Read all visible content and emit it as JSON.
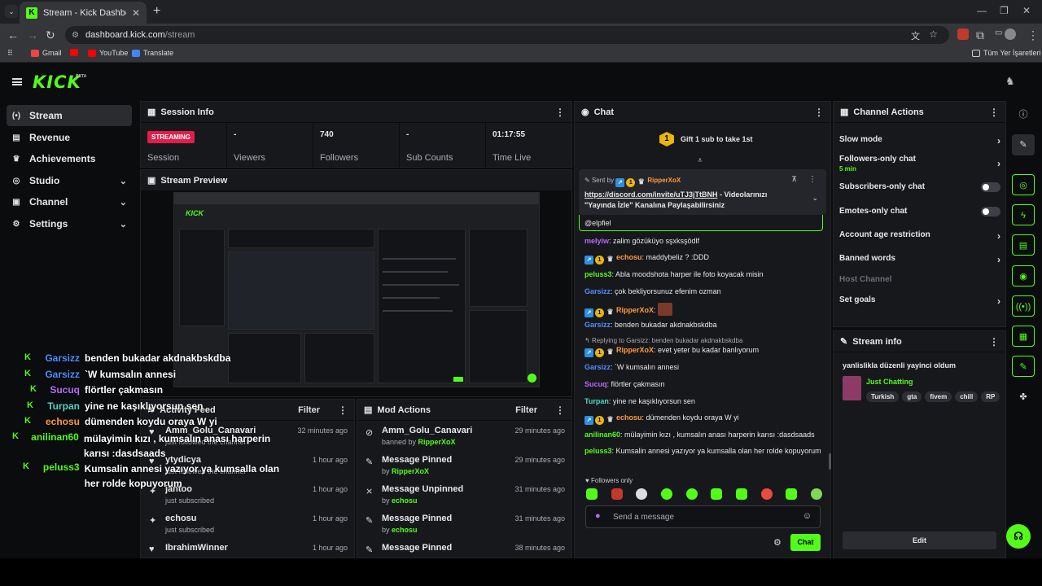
{
  "browser": {
    "tab_title": "Stream - Kick Dashboard",
    "url_host": "dashboard.kick.com",
    "url_path": "/stream",
    "bookmarks": [
      "Gmail",
      "YouTube",
      "Translate"
    ],
    "other_bookmarks": "Tüm Yer İşaretleri"
  },
  "header": {
    "logo": "KICK",
    "beta": "BETA"
  },
  "sidebar": {
    "items": [
      {
        "label": "Stream",
        "icon": "broadcast-icon"
      },
      {
        "label": "Revenue",
        "icon": "revenue-icon"
      },
      {
        "label": "Achievements",
        "icon": "trophy-icon"
      },
      {
        "label": "Studio",
        "icon": "studio-icon"
      },
      {
        "label": "Channel",
        "icon": "channel-icon"
      },
      {
        "label": "Settings",
        "icon": "gear-icon"
      }
    ]
  },
  "session": {
    "title": "Session Info",
    "status": "STREAMING",
    "cells": [
      {
        "value": "",
        "label": "Session"
      },
      {
        "value": "-",
        "label": "Viewers"
      },
      {
        "value": "740",
        "label": "Followers"
      },
      {
        "value": "-",
        "label": "Sub Counts"
      },
      {
        "value": "01:17:55",
        "label": "Time Live"
      }
    ]
  },
  "preview": {
    "title": "Stream Preview"
  },
  "overlay_chat": [
    {
      "name": "Garsizz",
      "color": "#4f8fff",
      "msg": "benden bukadar akdnakbskdba"
    },
    {
      "name": "Garsizz",
      "color": "#4f8fff",
      "msg": "`W kumsalın annesi"
    },
    {
      "name": "Sucuq",
      "color": "#b76bff",
      "msg": "flörtler çakmasın"
    },
    {
      "name": "Turpan",
      "color": "#4fd6c8",
      "msg": "yine ne kaşıklıyorsun sen"
    },
    {
      "name": "echosu",
      "color": "#ff9a3c",
      "msg": "dümenden koydu oraya W yi"
    },
    {
      "name": "anilinan60",
      "color": "#53fc18",
      "msg": "mülayimin kızı , kumsalın anası harperin karısı :dasdsaads"
    },
    {
      "name": "peluss3",
      "color": "#53fc18",
      "msg": "Kumsalin annesi yazıyor ya kumsalla olan her rolde kopuyorum"
    }
  ],
  "activity": {
    "title": "Activity Feed",
    "filter": "Filter",
    "rows": [
      {
        "name": "Amm_Golu_Canavari",
        "sub": "just followed the channel",
        "time": "32 minutes ago",
        "icon": "heart-icon"
      },
      {
        "name": "ytydicya",
        "sub": "just followed the channel",
        "time": "1 hour ago",
        "icon": "heart-icon"
      },
      {
        "name": "jantoo",
        "sub": "just subscribed",
        "time": "1 hour ago",
        "icon": "star-icon"
      },
      {
        "name": "echosu",
        "sub": "just subscribed",
        "time": "1 hour ago",
        "icon": "star-icon"
      },
      {
        "name": "IbrahimWinner",
        "sub": "",
        "time": "1 hour ago",
        "icon": "heart-icon"
      }
    ]
  },
  "modactions": {
    "title": "Mod Actions",
    "filter": "Filter",
    "rows": [
      {
        "name": "Amm_Golu_Canavari",
        "pre": "banned by ",
        "by": "RipperXoX",
        "time": "29 minutes ago",
        "icon": "ban-icon"
      },
      {
        "name": "Message Pinned",
        "pre": "by ",
        "by": "RipperXoX",
        "time": "29 minutes ago",
        "icon": "pin-icon"
      },
      {
        "name": "Message Unpinned",
        "pre": "by ",
        "by": "echosu",
        "time": "31 minutes ago",
        "icon": "unpin-icon"
      },
      {
        "name": "Message Pinned",
        "pre": "by ",
        "by": "echosu",
        "time": "31 minutes ago",
        "icon": "pin-icon"
      },
      {
        "name": "Message Pinned",
        "pre": "",
        "by": "",
        "time": "38 minutes ago",
        "icon": "pin-icon"
      }
    ]
  },
  "chat": {
    "title": "Chat",
    "gift_text": "Gift 1 sub to take 1st",
    "gift_count": "1",
    "pinned": {
      "sent_by": "Sent by",
      "user": "RipperXoX",
      "link": "https://discord.com/invite/uTJ3jTtBNH",
      "text": " - Videolarınızı \"Yayında İzle\" Kanalına Paylaşabilirsiniz"
    },
    "partial": "@elpfiel",
    "messages": [
      {
        "name": "melyiw",
        "color": "#b76bff",
        "badges": 0,
        "text": ": zalim gözüküyo sşxksşödlf"
      },
      {
        "name": "echosu",
        "color": "#ff9a3c",
        "badges": 3,
        "text": ": maddybeliz ? :DDD"
      },
      {
        "name": "peluss3",
        "color": "#53fc18",
        "badges": 0,
        "text": ": Abla moodshota harper ile foto koyacak misin"
      },
      {
        "name": "Garsizz",
        "color": "#4f8fff",
        "badges": 0,
        "text": ": çok bekliyorsunuz efenim ozman"
      },
      {
        "name": "RipperXoX",
        "color": "#ff9a3c",
        "badges": 3,
        "text": ":"
      },
      {
        "name": "Garsizz",
        "color": "#4f8fff",
        "badges": 0,
        "text": ": benden bukadar akdnakbskdba"
      },
      {
        "name": "RipperXoX",
        "color": "#ff9a3c",
        "badges": 3,
        "text": ": evet yeter bu kadar banlıyorum"
      },
      {
        "name": "Garsizz",
        "color": "#4f8fff",
        "badges": 0,
        "text": ": `W kumsalın annesi"
      },
      {
        "name": "Sucuq",
        "color": "#b76bff",
        "badges": 0,
        "text": ": flörtler çakmasın"
      },
      {
        "name": "Turpan",
        "color": "#4fd6c8",
        "badges": 0,
        "text": ": yine ne kaşıklıyorsun sen"
      },
      {
        "name": "echosu",
        "color": "#ff9a3c",
        "badges": 3,
        "text": ": dümenden koydu oraya W yi"
      },
      {
        "name": "anilinan60",
        "color": "#53fc18",
        "badges": 0,
        "text": ": mülayimin kızı , kumsalın anası harperin karısı :dasdsaads"
      },
      {
        "name": "peluss3",
        "color": "#53fc18",
        "badges": 0,
        "text": ": Kumsalin annesi yazıyor ya kumsalla olan her rolde kopuyorum"
      }
    ],
    "reply_text": "Replying to Garsizz: benden bukadar akdnakbskdba",
    "followers_only": "Followers only",
    "input_placeholder": "Send a message",
    "send_label": "Chat"
  },
  "channel_actions": {
    "title": "Channel Actions",
    "rows": [
      {
        "label": "Slow mode",
        "kind": "chevron"
      },
      {
        "label": "Followers-only chat",
        "sub": "5 min",
        "kind": "chevron"
      },
      {
        "label": "Subscribers-only chat",
        "kind": "toggle"
      },
      {
        "label": "Emotes-only chat",
        "kind": "toggle"
      },
      {
        "label": "Account age restriction",
        "kind": "chevron"
      },
      {
        "label": "Banned words",
        "kind": "chevron"
      },
      {
        "label": "Host Channel",
        "kind": "disabled"
      },
      {
        "label": "Set goals",
        "kind": "chevron"
      }
    ]
  },
  "stream_info": {
    "title": "Stream info",
    "stream_title": "yanlislikla düzenli yayinci oldum",
    "category": "Just Chatting",
    "tags": [
      "Turkish",
      "gta",
      "fivem",
      "chill",
      "RP"
    ],
    "edit_label": "Edit"
  }
}
